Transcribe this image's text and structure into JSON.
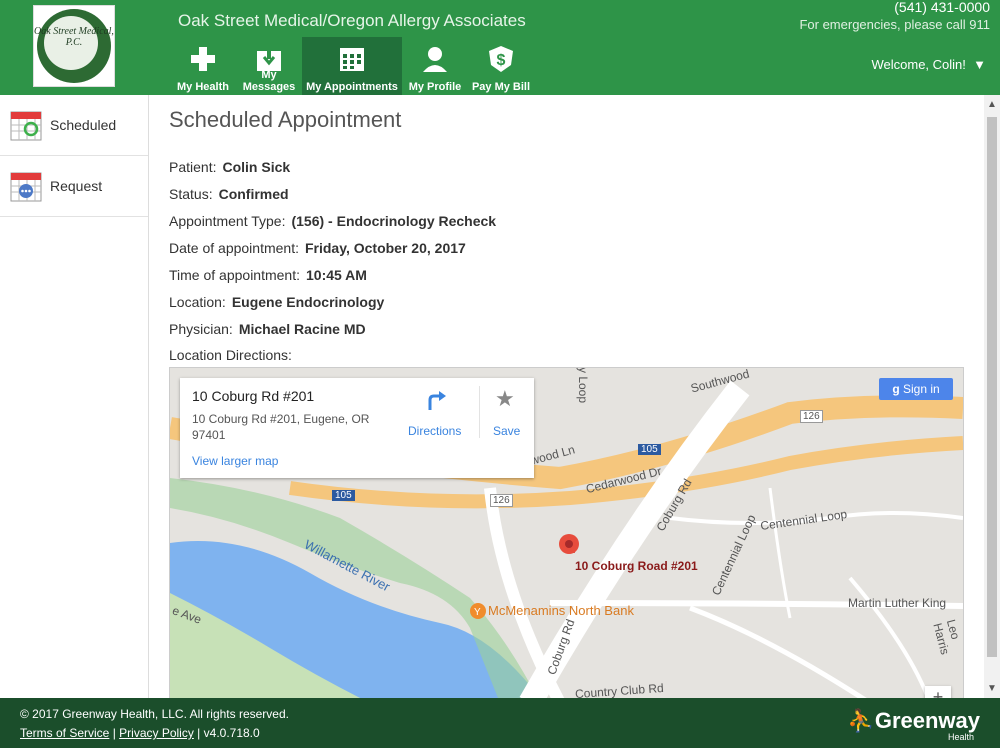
{
  "header": {
    "title": "Oak Street Medical/Oregon Allergy Associates",
    "logo_text": "Oak Street Medical, P.C.",
    "phone": "(541) 431-0000",
    "emergency": "For emergencies, please call 911",
    "welcome": "Welcome, Colin!",
    "nav": [
      {
        "label": "My Health",
        "icon": "plus-icon"
      },
      {
        "label": "My Messages",
        "icon": "inbox-icon"
      },
      {
        "label": "My Appointments",
        "icon": "calendar-icon",
        "active": true
      },
      {
        "label": "My Profile",
        "icon": "person-icon"
      },
      {
        "label": "Pay My Bill",
        "icon": "dollar-icon"
      }
    ]
  },
  "sidebar": {
    "items": [
      {
        "label": "Scheduled",
        "icon": "calendar-check-icon",
        "active": true
      },
      {
        "label": "Request",
        "icon": "calendar-dots-icon"
      }
    ]
  },
  "appointment": {
    "title": "Scheduled Appointment",
    "patient_label": "Patient:",
    "patient": "Colin Sick",
    "status_label": "Status:",
    "status": "Confirmed",
    "type_label": "Appointment Type:",
    "type": "(156) - Endocrinology Recheck",
    "date_label": "Date of appointment:",
    "date": "Friday, October 20, 2017",
    "time_label": "Time of appointment:",
    "time": "10:45 AM",
    "location_label": "Location:",
    "location": "Eugene Endocrinology",
    "physician_label": "Physician:",
    "physician": "Michael Racine MD",
    "directions_label": "Location Directions:"
  },
  "map": {
    "card_title": "10 Coburg Rd #201",
    "card_address": "10 Coburg Rd #201, Eugene, OR 97401",
    "directions": "Directions",
    "save": "Save",
    "view_larger": "View larger map",
    "sign_in": "Sign in",
    "pin_label": "10 Coburg Road #201",
    "poi": "McMenamins North Bank",
    "labels": {
      "river": "Willamette River",
      "coburg": "Coburg Rd",
      "coburg2": "Coburg Rd",
      "cedarwood": "Cedarwood Dr",
      "centennial": "Centennial Loop",
      "centennial2": "Centennial Loop",
      "mlk": "Martin Luther King",
      "country": "Country Club Rd",
      "southwood": "Southwood",
      "wood": "wood Ln",
      "leo": "Leo Harris",
      "ave": "e Ave",
      "loop": "y Loop",
      "r126a": "126",
      "r126b": "126",
      "i105a": "105",
      "i105b": "105"
    }
  },
  "footer": {
    "copyright": "© 2017 Greenway Health, LLC. All rights reserved.",
    "terms": "Terms of Service",
    "privacy": "Privacy Policy",
    "version": "v4.0.718.0",
    "brand": "Greenway",
    "brand_sub": "Health"
  },
  "colors": {
    "header": "#2e9448",
    "active_nav": "#21703a",
    "footer": "#1b4e2b",
    "link": "#3a84df"
  }
}
